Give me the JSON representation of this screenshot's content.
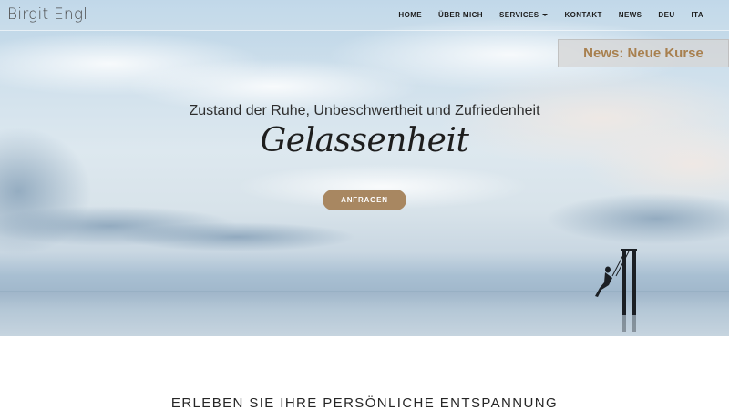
{
  "brand": {
    "name": "Birgit Engl"
  },
  "nav": {
    "items": [
      {
        "label": "HOME"
      },
      {
        "label": "ÜBER MICH"
      },
      {
        "label": "SERVICES",
        "dropdown": true
      },
      {
        "label": "KONTAKT"
      },
      {
        "label": "NEWS"
      },
      {
        "label": "DEU"
      },
      {
        "label": "ITA"
      }
    ]
  },
  "news_badge": {
    "label": "News: Neue Kurse",
    "color": "#a8804f"
  },
  "hero": {
    "subtitle": "Zustand der Ruhe, Unbeschwertheit und Zufriedenheit",
    "headline": "Gelassenheit",
    "cta_label": "ANFRAGEN",
    "cta_color": "#a88761"
  },
  "section": {
    "title": "ERLEBEN SIE IHRE PERSÖNLICHE ENTSPANNUNG"
  }
}
